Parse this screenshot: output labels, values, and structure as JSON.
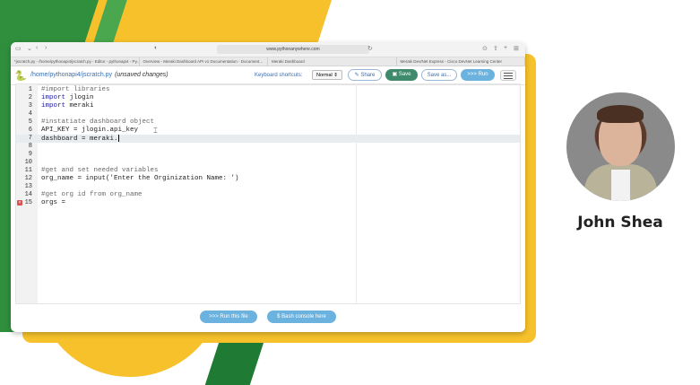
{
  "browser": {
    "url": "www.pythonanywhere.com",
    "tabs": [
      "*jscratch.py - /home/pythonapi4/jscratch.py - Editor - pythonapi4 - Py...",
      "Overview - Meraki Dashboard API v1 Documentation - Document...",
      "Meraki Dashboard",
      "Meraki Dev/Net Express - Cisco DevNet Learning Center"
    ]
  },
  "editor": {
    "file_path": "/home/pythonapi4/jscratch.py",
    "unsaved_label": "(unsaved changes)",
    "keyboard_label": "Keyboard shortcuts:",
    "keyboard_mode": "Normal",
    "share_label": "Share",
    "save_label": "Save",
    "save_as_label": "Save as...",
    "run_label": ">>> Run",
    "lines": [
      {
        "n": "1",
        "text": "#import libraries"
      },
      {
        "n": "2",
        "kw": "import",
        "text": " jlogin"
      },
      {
        "n": "3",
        "kw": "import",
        "text": " meraki"
      },
      {
        "n": "4",
        "text": ""
      },
      {
        "n": "5",
        "text": "#instatiate dashboard object"
      },
      {
        "n": "6",
        "text": "API_KEY = jlogin.api_key"
      },
      {
        "n": "7",
        "text": "dashboard = meraki."
      },
      {
        "n": "8",
        "text": ""
      },
      {
        "n": "9",
        "text": ""
      },
      {
        "n": "10",
        "text": ""
      },
      {
        "n": "11",
        "text": "#get and set needed variables"
      },
      {
        "n": "12",
        "text": "org_name = input('Enter the Orginization Name: ')"
      },
      {
        "n": "13",
        "text": ""
      },
      {
        "n": "14",
        "text": "#get org id from org_name"
      },
      {
        "n": "15",
        "text": "orgs ="
      }
    ],
    "run_file_label": ">>> Run this file",
    "bash_label": "$ Bash console here"
  },
  "presenter": {
    "name": "John Shea"
  },
  "colors": {
    "yellow": "#f6c12b",
    "green": "#2f8f3c",
    "save_button": "#3f8a6d",
    "run_button": "#6bb2de"
  }
}
